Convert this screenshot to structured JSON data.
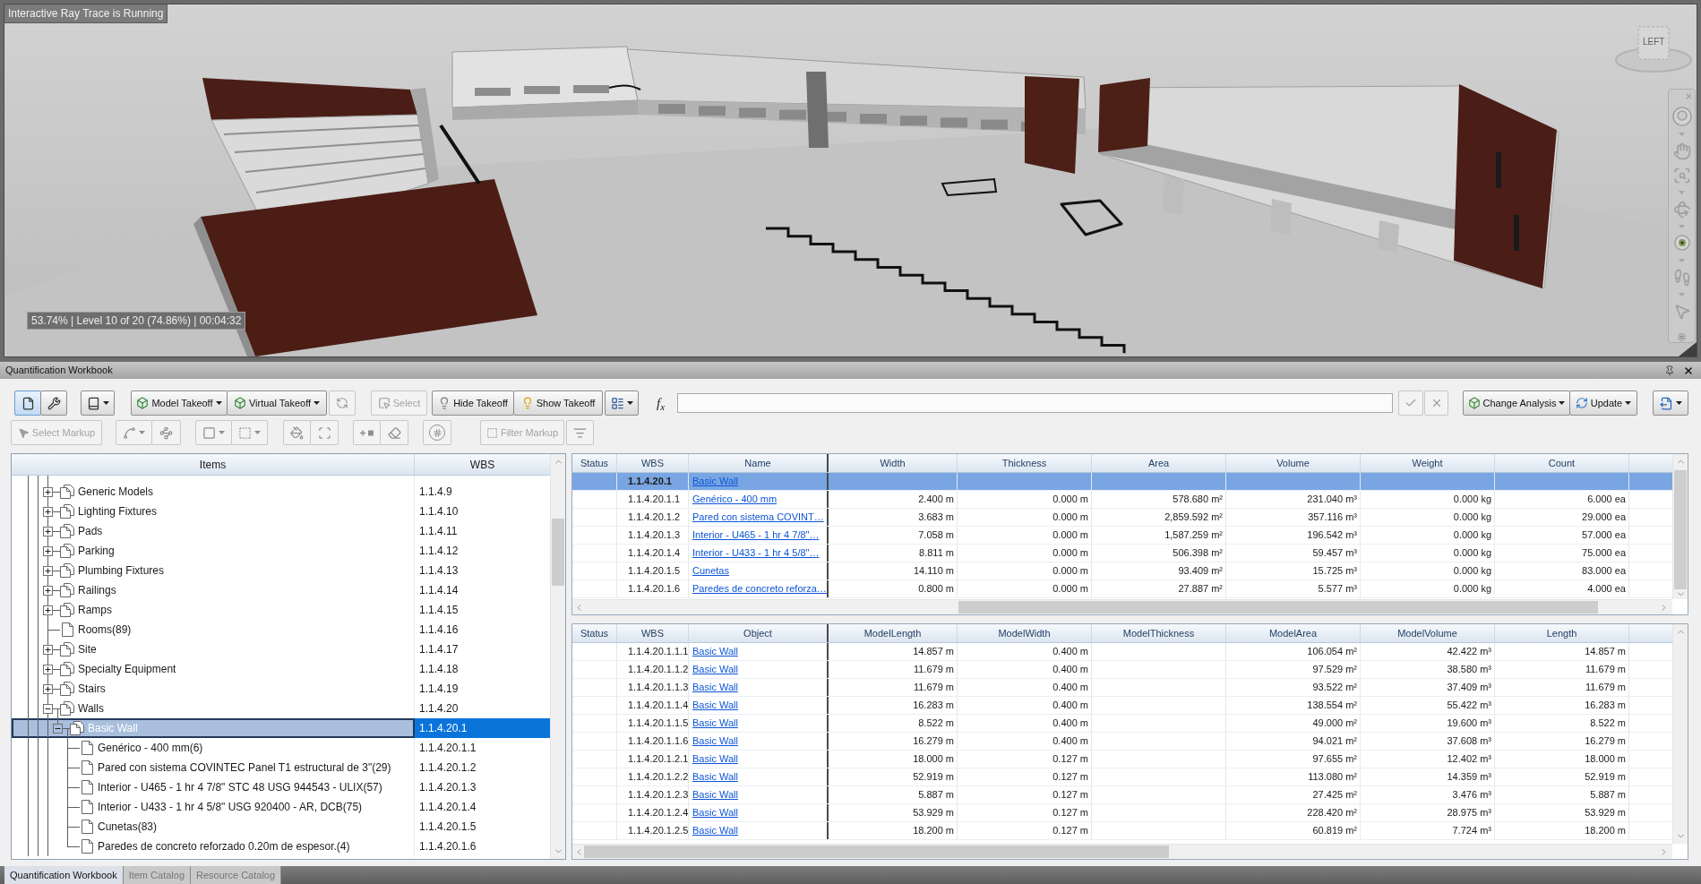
{
  "viewport": {
    "status": "Interactive Ray Trace is Running",
    "progress": "53.74% | Level 10 of 20 (74.86%) | 00:04:32",
    "viewcube_face": "LEFT"
  },
  "workbook": {
    "title": "Quantification Workbook"
  },
  "toolbar": {
    "modes": [
      {
        "selected": true
      },
      {
        "selected": false
      }
    ],
    "takeoff": [
      {
        "label": "Model Takeoff"
      },
      {
        "label": "Virtual Takeoff"
      }
    ],
    "takeoff_tool": {
      "disabled": true
    },
    "select": {
      "label": "Select",
      "disabled": true
    },
    "visibility": [
      {
        "label": "Hide Takeoff"
      },
      {
        "label": "Show Takeoff"
      }
    ],
    "formula_label": "f$_{x}$",
    "formula_actions": [
      {
        "disabled": true
      },
      {
        "disabled": true
      }
    ],
    "analysis": [
      {
        "label": "Change Analysis"
      },
      {
        "label": "Update"
      }
    ]
  },
  "markup_toolbar": {
    "select_markup": {
      "label": "Select Markup",
      "disabled": true
    },
    "tools": [
      {
        "kind": "dropdown",
        "disabled": true
      },
      {
        "kind": "button",
        "disabled": true
      },
      {
        "kind": "dropdown",
        "disabled": true
      },
      {
        "kind": "dropdown",
        "disabled": true
      },
      {
        "kind": "button",
        "disabled": true
      },
      {
        "kind": "button",
        "disabled": true
      },
      {
        "kind": "button",
        "disabled": true
      },
      {
        "kind": "button",
        "disabled": true
      },
      {
        "kind": "button",
        "disabled": true
      }
    ],
    "filter_markup": {
      "label": "Filter Markup",
      "disabled": true
    },
    "filter_tool": {
      "disabled": true
    }
  },
  "items_tree": {
    "columns": [
      "Items",
      "WBS"
    ],
    "nodes": [
      {
        "label": "Generic Models",
        "wbs": "1.1.4.9",
        "expanded": false,
        "selected": false
      },
      {
        "label": "Lighting Fixtures",
        "wbs": "1.1.4.10",
        "expanded": false,
        "selected": false
      },
      {
        "label": "Pads",
        "wbs": "1.1.4.11",
        "expanded": false,
        "selected": false
      },
      {
        "label": "Parking",
        "wbs": "1.1.4.12",
        "expanded": false,
        "selected": false
      },
      {
        "label": "Plumbing Fixtures",
        "wbs": "1.1.4.13",
        "expanded": false,
        "selected": false
      },
      {
        "label": "Railings",
        "wbs": "1.1.4.14",
        "expanded": false,
        "selected": false
      },
      {
        "label": "Ramps",
        "wbs": "1.1.4.15",
        "expanded": false,
        "selected": false
      },
      {
        "label": "Rooms(89)",
        "wbs": "1.1.4.16",
        "selected": false
      },
      {
        "label": "Site",
        "wbs": "1.1.4.17",
        "expanded": false,
        "selected": false
      },
      {
        "label": "Specialty Equipment",
        "wbs": "1.1.4.18",
        "expanded": false,
        "selected": false
      },
      {
        "label": "Stairs",
        "wbs": "1.1.4.19",
        "expanded": false,
        "selected": false
      },
      {
        "label": "Walls",
        "wbs": "1.1.4.20",
        "expanded": true,
        "selected": false,
        "children": [
          {
            "label": "Basic Wall",
            "wbs": "1.1.4.20.1",
            "expanded": true,
            "selected": true,
            "children": [
              {
                "label": "Genérico - 400 mm(6)",
                "wbs": "1.1.4.20.1.1",
                "selected": false
              },
              {
                "label": "Pared con sistema COVINTEC Panel T1 estructural de 3\"(29)",
                "wbs": "1.1.4.20.1.2",
                "selected": false
              },
              {
                "label": "Interior - U465 - 1 hr 4 7/8\" STC 48 USG 944543 - ULIX(57)",
                "wbs": "1.1.4.20.1.3",
                "selected": false
              },
              {
                "label": "Interior - U433 - 1 hr 4 5/8\" USG 920400 - AR, DCB(75)",
                "wbs": "1.1.4.20.1.4",
                "selected": false
              },
              {
                "label": "Cunetas(83)",
                "wbs": "1.1.4.20.1.5",
                "selected": false
              },
              {
                "label": "Paredes de concreto reforzado 0.20m de espesor.(4)",
                "wbs": "1.1.4.20.1.6",
                "selected": false
              }
            ]
          }
        ]
      }
    ]
  },
  "quantities_grid": {
    "columns": [
      "Status",
      "WBS",
      "Name",
      "Width",
      "Thickness",
      "Area",
      "Volume",
      "Weight",
      "Count"
    ],
    "rows": [
      {
        "wbs": "1.1.4.20.1",
        "name": "Basic Wall",
        "selected": true
      },
      {
        "wbs": "1.1.4.20.1.1",
        "name": "Genérico - 400 mm",
        "values": {
          "width": "2.400 m",
          "thickness": "0.000 m",
          "area": "578.680 m²",
          "volume": "231.040 m³",
          "weight": "0.000 kg",
          "count": "6.000 ea"
        },
        "selected": false
      },
      {
        "wbs": "1.1.4.20.1.2",
        "name": "Pared con sistema COVINT…",
        "values": {
          "width": "3.683 m",
          "thickness": "0.000 m",
          "area": "2,859.592 m²",
          "volume": "357.116 m³",
          "weight": "0.000 kg",
          "count": "29.000 ea"
        },
        "selected": false
      },
      {
        "wbs": "1.1.4.20.1.3",
        "name": "Interior - U465 - 1 hr 4 7/8\"…",
        "values": {
          "width": "7.058 m",
          "thickness": "0.000 m",
          "area": "1,587.259 m²",
          "volume": "196.542 m³",
          "weight": "0.000 kg",
          "count": "57.000 ea"
        },
        "selected": false
      },
      {
        "wbs": "1.1.4.20.1.4",
        "name": "Interior - U433 - 1 hr 4 5/8\"…",
        "values": {
          "width": "8.811 m",
          "thickness": "0.000 m",
          "area": "506.398 m²",
          "volume": "59.457 m³",
          "weight": "0.000 kg",
          "count": "75.000 ea"
        },
        "selected": false
      },
      {
        "wbs": "1.1.4.20.1.5",
        "name": "Cunetas",
        "values": {
          "width": "14.110 m",
          "thickness": "0.000 m",
          "area": "93.409 m²",
          "volume": "15.725 m³",
          "weight": "0.000 kg",
          "count": "83.000 ea"
        },
        "selected": false
      },
      {
        "wbs": "1.1.4.20.1.6",
        "name": "Paredes de concreto reforza…",
        "values": {
          "width": "0.800 m",
          "thickness": "0.000 m",
          "area": "27.887 m²",
          "volume": "5.577 m³",
          "weight": "0.000 kg",
          "count": "4.000 ea"
        },
        "selected": false
      }
    ]
  },
  "objects_grid": {
    "columns": [
      "Status",
      "WBS",
      "Object",
      "ModelLength",
      "ModelWidth",
      "ModelThickness",
      "ModelArea",
      "ModelVolume",
      "Length"
    ],
    "rows": [
      {
        "wbs": "1.1.4.20.1.1.1",
        "object": "Basic Wall",
        "values": {
          "model_length": "14.857 m",
          "model_width": "0.400 m",
          "model_area": "106.054 m²",
          "model_volume": "42.422 m³",
          "length": "14.857 m"
        },
        "selected": false
      },
      {
        "wbs": "1.1.4.20.1.1.2",
        "object": "Basic Wall",
        "values": {
          "model_length": "11.679 m",
          "model_width": "0.400 m",
          "model_area": "97.529 m²",
          "model_volume": "38.580 m³",
          "length": "11.679 m"
        },
        "selected": false
      },
      {
        "wbs": "1.1.4.20.1.1.3",
        "object": "Basic Wall",
        "values": {
          "model_length": "11.679 m",
          "model_width": "0.400 m",
          "model_area": "93.522 m²",
          "model_volume": "37.409 m³",
          "length": "11.679 m"
        },
        "selected": false
      },
      {
        "wbs": "1.1.4.20.1.1.4",
        "object": "Basic Wall",
        "values": {
          "model_length": "16.283 m",
          "model_width": "0.400 m",
          "model_area": "138.554 m²",
          "model_volume": "55.422 m³",
          "length": "16.283 m"
        },
        "selected": false
      },
      {
        "wbs": "1.1.4.20.1.1.5",
        "object": "Basic Wall",
        "values": {
          "model_length": "8.522 m",
          "model_width": "0.400 m",
          "model_area": "49.000 m²",
          "model_volume": "19.600 m³",
          "length": "8.522 m"
        },
        "selected": false
      },
      {
        "wbs": "1.1.4.20.1.1.6",
        "object": "Basic Wall",
        "values": {
          "model_length": "16.279 m",
          "model_width": "0.400 m",
          "model_area": "94.021 m²",
          "model_volume": "37.608 m³",
          "length": "16.279 m"
        },
        "selected": false
      },
      {
        "wbs": "1.1.4.20.1.2.1",
        "object": "Basic Wall",
        "values": {
          "model_length": "18.000 m",
          "model_width": "0.127 m",
          "model_area": "97.655 m²",
          "model_volume": "12.402 m³",
          "length": "18.000 m"
        },
        "selected": false
      },
      {
        "wbs": "1.1.4.20.1.2.2",
        "object": "Basic Wall",
        "values": {
          "model_length": "52.919 m",
          "model_width": "0.127 m",
          "model_area": "113.080 m²",
          "model_volume": "14.359 m³",
          "length": "52.919 m"
        },
        "selected": false
      },
      {
        "wbs": "1.1.4.20.1.2.3",
        "object": "Basic Wall",
        "values": {
          "model_length": "5.887 m",
          "model_width": "0.127 m",
          "model_area": "27.425 m²",
          "model_volume": "3.476 m³",
          "length": "5.887 m"
        },
        "selected": false
      },
      {
        "wbs": "1.1.4.20.1.2.4",
        "object": "Basic Wall",
        "values": {
          "model_length": "53.929 m",
          "model_width": "0.127 m",
          "model_area": "228.420 m²",
          "model_volume": "28.975 m³",
          "length": "53.929 m"
        },
        "selected": false
      },
      {
        "wbs": "1.1.4.20.1.2.5",
        "object": "Basic Wall",
        "values": {
          "model_length": "18.200 m",
          "model_width": "0.127 m",
          "model_area": "60.819 m²",
          "model_volume": "7.724 m³",
          "length": "18.200 m"
        },
        "selected": false
      }
    ]
  },
  "bottom_tabs": [
    {
      "label": "Quantification Workbook",
      "selected": true
    },
    {
      "label": "Item Catalog",
      "selected": false
    },
    {
      "label": "Resource Catalog",
      "selected": false
    }
  ]
}
